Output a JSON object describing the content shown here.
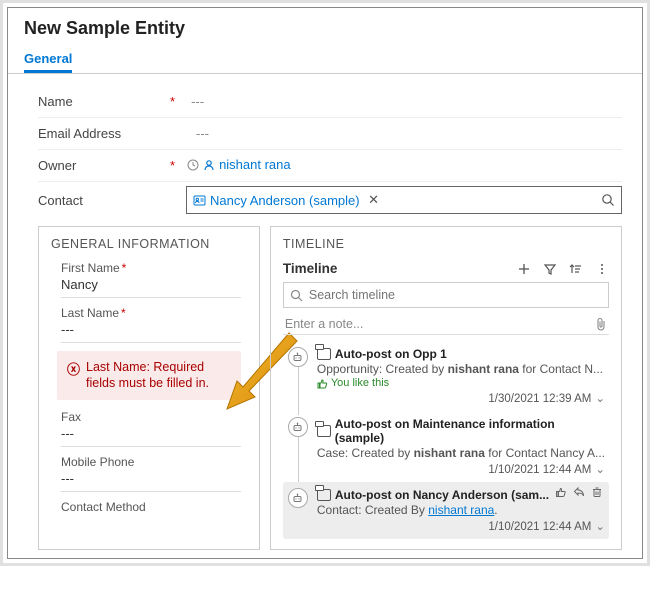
{
  "header": {
    "title": "New Sample Entity",
    "tab_general": "General"
  },
  "form": {
    "name_label": "Name",
    "name_value": "---",
    "email_label": "Email Address",
    "email_value": "---",
    "owner_label": "Owner",
    "owner_value": "nishant rana",
    "contact_label": "Contact",
    "contact_value": "Nancy Anderson (sample)"
  },
  "general_info": {
    "header": "GENERAL INFORMATION",
    "first_name_label": "First Name",
    "first_name_value": "Nancy",
    "last_name_label": "Last Name",
    "last_name_value": "---",
    "error": "Last Name: Required fields must be filled in.",
    "fax_label": "Fax",
    "fax_value": "---",
    "mobile_label": "Mobile Phone",
    "mobile_value": "---",
    "method_label": "Contact Method"
  },
  "timeline": {
    "header": "TIMELINE",
    "title": "Timeline",
    "search_placeholder": "Search timeline",
    "note_placeholder": "Enter a note...",
    "items": [
      {
        "title": "Auto-post on Opp 1",
        "desc_pre": "Opportunity: Created by ",
        "desc_bold": "nishant rana",
        "desc_post": " for Contact N...",
        "like": "You like this",
        "date": "1/30/2021 12:39 AM"
      },
      {
        "title": "Auto-post on Maintenance information (sample)",
        "desc_pre": "Case: Created by ",
        "desc_bold": "nishant rana",
        "desc_post": " for Contact Nancy A...",
        "date": "1/10/2021 12:44 AM"
      },
      {
        "title": "Auto-post on Nancy Anderson (sam...",
        "desc_pre": "Contact: Created By ",
        "desc_link": "nishant rana",
        "desc_post": ".",
        "date": "1/10/2021 12:44 AM",
        "selected": true
      }
    ]
  }
}
